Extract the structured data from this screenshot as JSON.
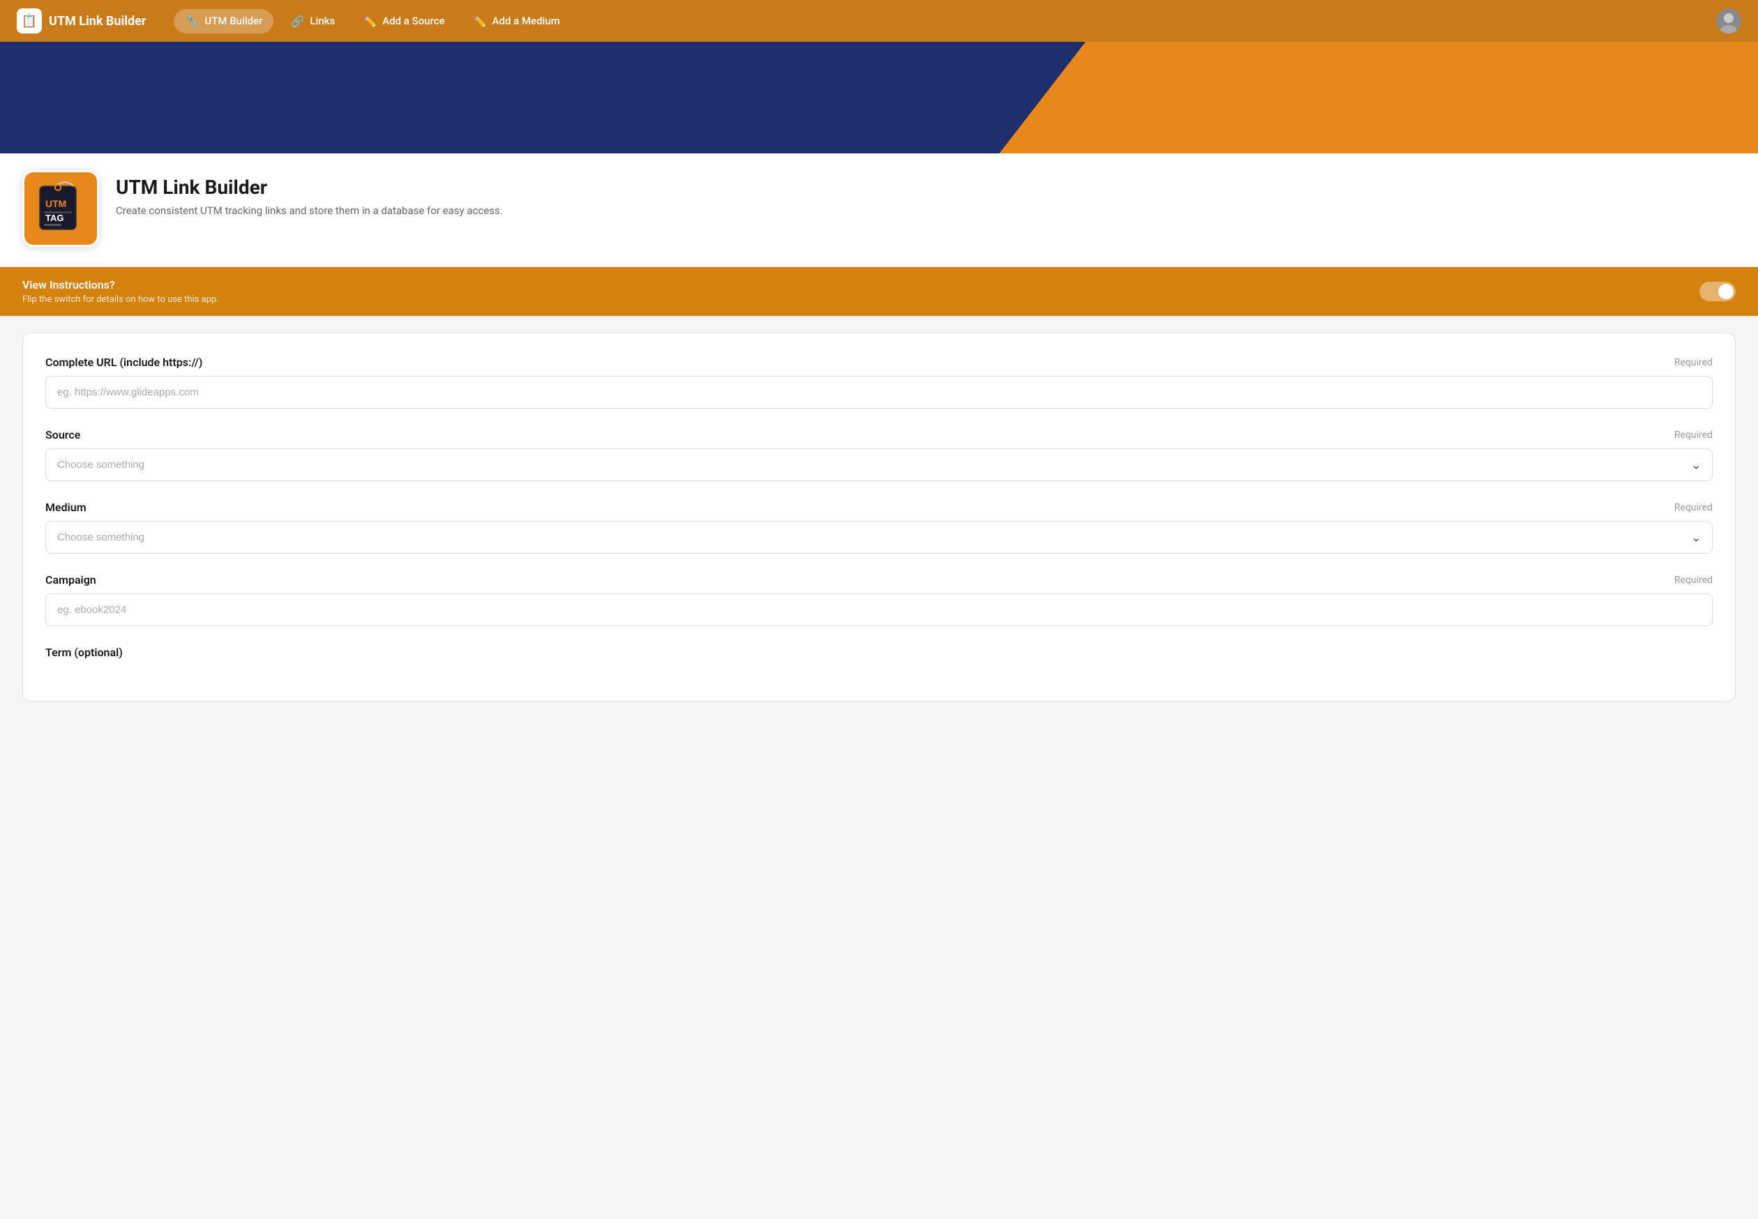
{
  "navbar": {
    "brand_label": "UTM Link Builder",
    "tabs": [
      {
        "id": "utm-builder",
        "label": "UTM Builder",
        "icon": "🔧",
        "active": true
      },
      {
        "id": "links",
        "label": "Links",
        "icon": "🔗",
        "active": false
      },
      {
        "id": "add-source",
        "label": "Add a Source",
        "icon": "✏️",
        "active": false
      },
      {
        "id": "add-medium",
        "label": "Add a Medium",
        "icon": "✏️",
        "active": false
      }
    ]
  },
  "app_header": {
    "title": "UTM Link Builder",
    "description": "Create consistent UTM tracking links and store them in a database for easy access."
  },
  "instructions": {
    "heading": "View Instructions?",
    "subtext": "Flip the switch for details on how to use this app."
  },
  "form": {
    "url_field": {
      "label": "Complete URL (include https://)",
      "required_label": "Required",
      "placeholder": "eg. https://www.glideapps.com",
      "value": ""
    },
    "source_field": {
      "label": "Source",
      "required_label": "Required",
      "placeholder": "Choose something",
      "options": []
    },
    "medium_field": {
      "label": "Medium",
      "required_label": "Required",
      "placeholder": "Choose something",
      "options": []
    },
    "campaign_field": {
      "label": "Campaign",
      "required_label": "Required",
      "placeholder": "eg. ebook2024",
      "value": ""
    },
    "term_field": {
      "label": "Term (optional)",
      "placeholder": ""
    }
  }
}
